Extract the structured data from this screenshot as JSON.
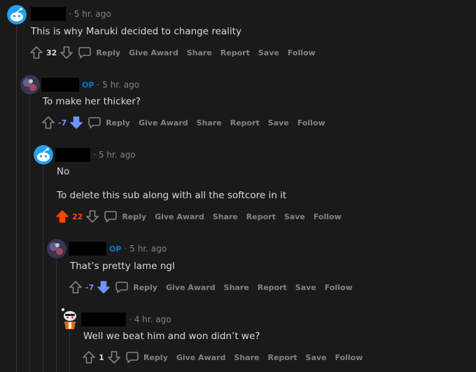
{
  "colors": {
    "background": "#1a1a1b",
    "text": "#d7dadc",
    "muted": "#818384",
    "op": "#0079d3",
    "upvote": "#ff4500",
    "downvote": "#7193ff"
  },
  "comments": [
    {
      "avatar_icon": "snoo-default-avatar-icon",
      "is_op": false,
      "time": "5 hr. ago",
      "paragraphs": [
        "This is why Maruki decided to change reality"
      ],
      "score": "32",
      "vote_state": "none"
    },
    {
      "avatar_icon": "user-avatar-icon",
      "is_op": true,
      "op_label": "OP",
      "time": "5 hr. ago",
      "paragraphs": [
        "To make her thicker?"
      ],
      "score": "-7",
      "vote_state": "down"
    },
    {
      "avatar_icon": "snoo-default-avatar-icon",
      "is_op": false,
      "time": "5 hr. ago",
      "paragraphs": [
        "No",
        "To delete this sub along with all the softcore in it"
      ],
      "score": "22",
      "vote_state": "up"
    },
    {
      "avatar_icon": "user-avatar-icon",
      "is_op": true,
      "op_label": "OP",
      "time": "5 hr. ago",
      "paragraphs": [
        "That’s pretty lame ngl"
      ],
      "score": "-7",
      "vote_state": "down"
    },
    {
      "avatar_icon": "snoo-custom-avatar-icon",
      "is_op": false,
      "time": "4 hr. ago",
      "paragraphs": [
        "Well we beat him and won didn’t we?"
      ],
      "score": "1",
      "vote_state": "none"
    }
  ],
  "actions": {
    "reply": "Reply",
    "give_award": "Give Award",
    "share": "Share",
    "report": "Report",
    "save": "Save",
    "follow": "Follow"
  },
  "separator": "·"
}
